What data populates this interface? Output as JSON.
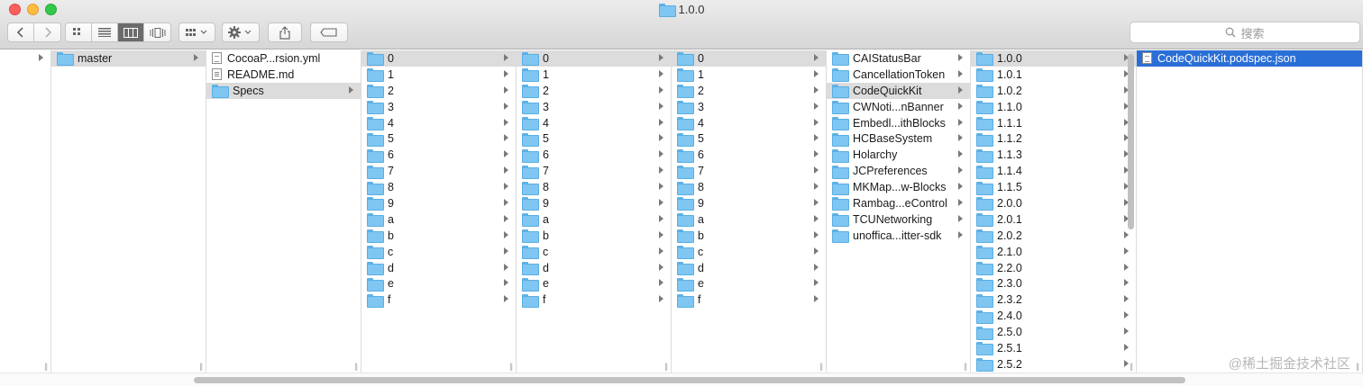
{
  "window": {
    "title": "1.0.0"
  },
  "toolbar": {
    "search_placeholder": "搜索",
    "icons": [
      "back-icon",
      "forward-icon",
      "icon-view-icon",
      "list-view-icon",
      "column-view-icon",
      "cover-flow-icon",
      "arrange-icon",
      "gear-icon",
      "share-icon",
      "tag-icon"
    ],
    "active_view": "columns"
  },
  "columns": [
    {
      "items": [
        {
          "label": "",
          "type": "folder",
          "arrow": true
        }
      ]
    },
    {
      "items": [
        {
          "label": "master",
          "type": "folder",
          "arrow": true,
          "selected": true
        }
      ]
    },
    {
      "items": [
        {
          "label": "CocoaP...rsion.yml",
          "type": "doc"
        },
        {
          "label": "README.md",
          "type": "txt"
        },
        {
          "label": "Specs",
          "type": "folder",
          "arrow": true,
          "selected": true
        }
      ]
    },
    {
      "items": [
        {
          "label": "0",
          "type": "folder",
          "arrow": true,
          "selected": true
        },
        {
          "label": "1",
          "type": "folder",
          "arrow": true
        },
        {
          "label": "2",
          "type": "folder",
          "arrow": true
        },
        {
          "label": "3",
          "type": "folder",
          "arrow": true
        },
        {
          "label": "4",
          "type": "folder",
          "arrow": true
        },
        {
          "label": "5",
          "type": "folder",
          "arrow": true
        },
        {
          "label": "6",
          "type": "folder",
          "arrow": true
        },
        {
          "label": "7",
          "type": "folder",
          "arrow": true
        },
        {
          "label": "8",
          "type": "folder",
          "arrow": true
        },
        {
          "label": "9",
          "type": "folder",
          "arrow": true
        },
        {
          "label": "a",
          "type": "folder",
          "arrow": true
        },
        {
          "label": "b",
          "type": "folder",
          "arrow": true
        },
        {
          "label": "c",
          "type": "folder",
          "arrow": true
        },
        {
          "label": "d",
          "type": "folder",
          "arrow": true
        },
        {
          "label": "e",
          "type": "folder",
          "arrow": true
        },
        {
          "label": "f",
          "type": "folder",
          "arrow": true
        }
      ]
    },
    {
      "items": [
        {
          "label": "0",
          "type": "folder",
          "arrow": true,
          "selected": true
        },
        {
          "label": "1",
          "type": "folder",
          "arrow": true
        },
        {
          "label": "2",
          "type": "folder",
          "arrow": true
        },
        {
          "label": "3",
          "type": "folder",
          "arrow": true
        },
        {
          "label": "4",
          "type": "folder",
          "arrow": true
        },
        {
          "label": "5",
          "type": "folder",
          "arrow": true
        },
        {
          "label": "6",
          "type": "folder",
          "arrow": true
        },
        {
          "label": "7",
          "type": "folder",
          "arrow": true
        },
        {
          "label": "8",
          "type": "folder",
          "arrow": true
        },
        {
          "label": "9",
          "type": "folder",
          "arrow": true
        },
        {
          "label": "a",
          "type": "folder",
          "arrow": true
        },
        {
          "label": "b",
          "type": "folder",
          "arrow": true
        },
        {
          "label": "c",
          "type": "folder",
          "arrow": true
        },
        {
          "label": "d",
          "type": "folder",
          "arrow": true
        },
        {
          "label": "e",
          "type": "folder",
          "arrow": true
        },
        {
          "label": "f",
          "type": "folder",
          "arrow": true
        }
      ]
    },
    {
      "items": [
        {
          "label": "0",
          "type": "folder",
          "arrow": true,
          "selected": true
        },
        {
          "label": "1",
          "type": "folder",
          "arrow": true
        },
        {
          "label": "2",
          "type": "folder",
          "arrow": true
        },
        {
          "label": "3",
          "type": "folder",
          "arrow": true
        },
        {
          "label": "4",
          "type": "folder",
          "arrow": true
        },
        {
          "label": "5",
          "type": "folder",
          "arrow": true
        },
        {
          "label": "6",
          "type": "folder",
          "arrow": true
        },
        {
          "label": "7",
          "type": "folder",
          "arrow": true
        },
        {
          "label": "8",
          "type": "folder",
          "arrow": true
        },
        {
          "label": "9",
          "type": "folder",
          "arrow": true
        },
        {
          "label": "a",
          "type": "folder",
          "arrow": true
        },
        {
          "label": "b",
          "type": "folder",
          "arrow": true
        },
        {
          "label": "c",
          "type": "folder",
          "arrow": true
        },
        {
          "label": "d",
          "type": "folder",
          "arrow": true
        },
        {
          "label": "e",
          "type": "folder",
          "arrow": true
        },
        {
          "label": "f",
          "type": "folder",
          "arrow": true
        }
      ]
    },
    {
      "items": [
        {
          "label": "CAIStatusBar",
          "type": "folder",
          "arrow": true
        },
        {
          "label": "CancellationToken",
          "type": "folder",
          "arrow": true
        },
        {
          "label": "CodeQuickKit",
          "type": "folder",
          "arrow": true,
          "selected": true
        },
        {
          "label": "CWNoti...nBanner",
          "type": "folder",
          "arrow": true
        },
        {
          "label": "Embedl...ithBlocks",
          "type": "folder",
          "arrow": true
        },
        {
          "label": "HCBaseSystem",
          "type": "folder",
          "arrow": true
        },
        {
          "label": "Holarchy",
          "type": "folder",
          "arrow": true
        },
        {
          "label": "JCPreferences",
          "type": "folder",
          "arrow": true
        },
        {
          "label": "MKMap...w-Blocks",
          "type": "folder",
          "arrow": true
        },
        {
          "label": "Rambag...eControl",
          "type": "folder",
          "arrow": true
        },
        {
          "label": "TCUNetworking",
          "type": "folder",
          "arrow": true
        },
        {
          "label": "unoffica...itter-sdk",
          "type": "folder",
          "arrow": true
        }
      ]
    },
    {
      "items": [
        {
          "label": "1.0.0",
          "type": "folder",
          "arrow": true,
          "selected": true
        },
        {
          "label": "1.0.1",
          "type": "folder",
          "arrow": true
        },
        {
          "label": "1.0.2",
          "type": "folder",
          "arrow": true
        },
        {
          "label": "1.1.0",
          "type": "folder",
          "arrow": true
        },
        {
          "label": "1.1.1",
          "type": "folder",
          "arrow": true
        },
        {
          "label": "1.1.2",
          "type": "folder",
          "arrow": true
        },
        {
          "label": "1.1.3",
          "type": "folder",
          "arrow": true
        },
        {
          "label": "1.1.4",
          "type": "folder",
          "arrow": true
        },
        {
          "label": "1.1.5",
          "type": "folder",
          "arrow": true
        },
        {
          "label": "2.0.0",
          "type": "folder",
          "arrow": true
        },
        {
          "label": "2.0.1",
          "type": "folder",
          "arrow": true
        },
        {
          "label": "2.0.2",
          "type": "folder",
          "arrow": true
        },
        {
          "label": "2.1.0",
          "type": "folder",
          "arrow": true
        },
        {
          "label": "2.2.0",
          "type": "folder",
          "arrow": true
        },
        {
          "label": "2.3.0",
          "type": "folder",
          "arrow": true
        },
        {
          "label": "2.3.2",
          "type": "folder",
          "arrow": true
        },
        {
          "label": "2.4.0",
          "type": "folder",
          "arrow": true
        },
        {
          "label": "2.5.0",
          "type": "folder",
          "arrow": true
        },
        {
          "label": "2.5.1",
          "type": "folder",
          "arrow": true
        },
        {
          "label": "2.5.2",
          "type": "folder",
          "arrow": true
        }
      ]
    },
    {
      "items": [
        {
          "label": "CodeQuickKit.podspec.json",
          "type": "doc",
          "selected_blue": true
        }
      ]
    }
  ],
  "watermark": "@稀土掘金技术社区"
}
